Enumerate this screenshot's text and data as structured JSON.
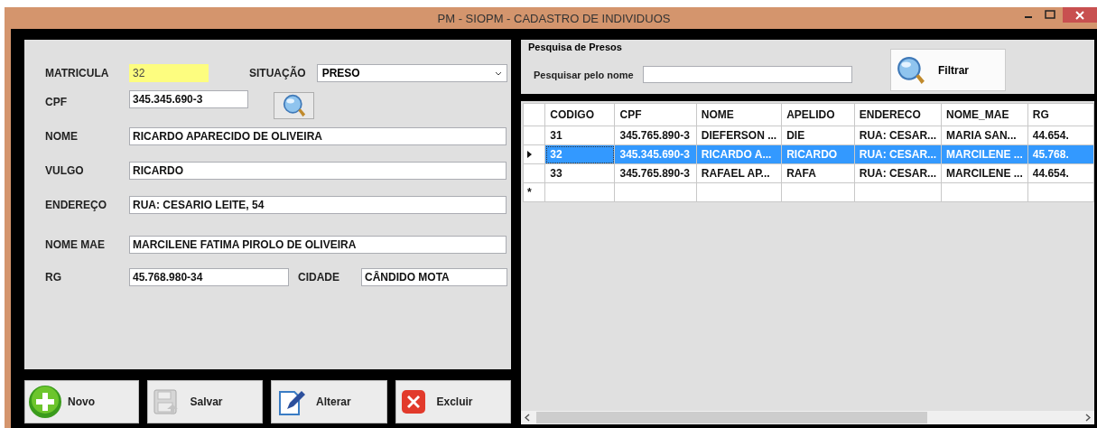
{
  "window": {
    "title": "PM - SIOPM - CADASTRO DE INDIVIDUOS"
  },
  "form": {
    "matricula": {
      "label": "MATRICULA",
      "value": "32",
      "focused": true
    },
    "situacao": {
      "label": "SITUAÇÃO",
      "value": "PRESO"
    },
    "cpf": {
      "label": "CPF",
      "value": "345.345.690-3"
    },
    "nome": {
      "label": "NOME",
      "value": "RICARDO APARECIDO DE OLIVEIRA"
    },
    "vulgo": {
      "label": "VULGO",
      "value": "RICARDO"
    },
    "endereco": {
      "label": "ENDEREÇO",
      "value": "RUA: CESARIO LEITE, 54"
    },
    "nome_mae": {
      "label": "NOME MAE",
      "value": "MARCILENE FATIMA PIROLO DE OLIVEIRA"
    },
    "rg": {
      "label": "RG",
      "value": "45.768.980-34"
    },
    "cidade": {
      "label": "CIDADE",
      "value": "CÂNDIDO MOTA"
    }
  },
  "buttons": [
    {
      "label": "Novo",
      "kind": "add"
    },
    {
      "label": "Salvar",
      "kind": "save"
    },
    {
      "label": "Alterar",
      "kind": "edit"
    },
    {
      "label": "Excluir",
      "kind": "delete"
    }
  ],
  "search": {
    "title": "Pesquisa de Presos",
    "label": "Pesquisar pelo nome",
    "button": "Filtrar"
  },
  "grid": {
    "columns": [
      "CODIGO",
      "CPF",
      "NOME",
      "APELIDO",
      "ENDERECO",
      "NOME_MAE",
      "RG"
    ],
    "rows": [
      {
        "selected": false,
        "cells": [
          "31",
          "345.765.890-3",
          "DIEFERSON ...",
          "DIE",
          "RUA: CESAR...",
          "MARIA SAN...",
          "44.654."
        ]
      },
      {
        "selected": true,
        "cells": [
          "32",
          "345.345.690-3",
          "RICARDO A...",
          "RICARDO",
          "RUA: CESAR...",
          "MARCILENE ...",
          "45.768."
        ]
      },
      {
        "selected": false,
        "cells": [
          "33",
          "345.765.890-3",
          "RAFAEL AP...",
          "RAFA",
          "RUA: CESAR...",
          "MARCILENE ...",
          "44.654."
        ]
      }
    ],
    "new_row_marker": "*"
  }
}
